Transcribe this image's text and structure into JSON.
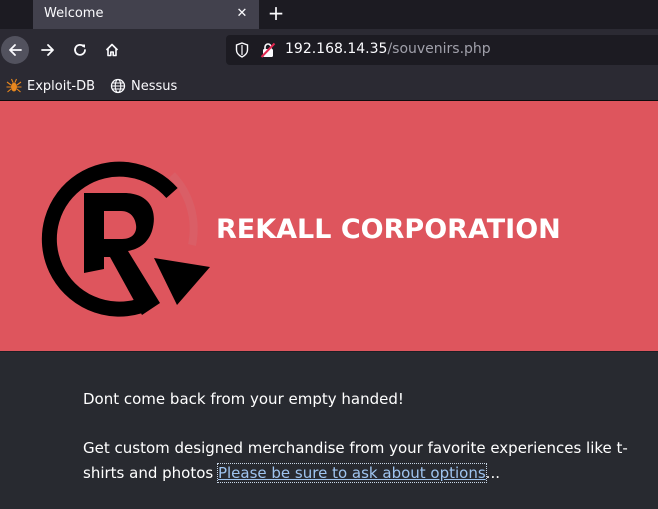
{
  "browser": {
    "tab": {
      "title": "Welcome",
      "close_glyph": "✕"
    },
    "new_tab_glyph": "+",
    "url": {
      "host": "192.168.14.35",
      "path": "/souvenirs.php"
    },
    "bookmarks": [
      {
        "label": "Exploit-DB",
        "icon": "exploit-db-icon"
      },
      {
        "label": "Nessus",
        "icon": "globe-icon"
      }
    ]
  },
  "page": {
    "brand": "REKALL CORPORATION",
    "hero_color": "#de555d",
    "paragraph1": "Dont come back from your empty handed!",
    "paragraph2_text": "Get custom designed merchandise from your favorite experiences like t-shirts and photos ",
    "paragraph2_link": "Please be sure to ask about options",
    "paragraph2_suffix": "..."
  }
}
